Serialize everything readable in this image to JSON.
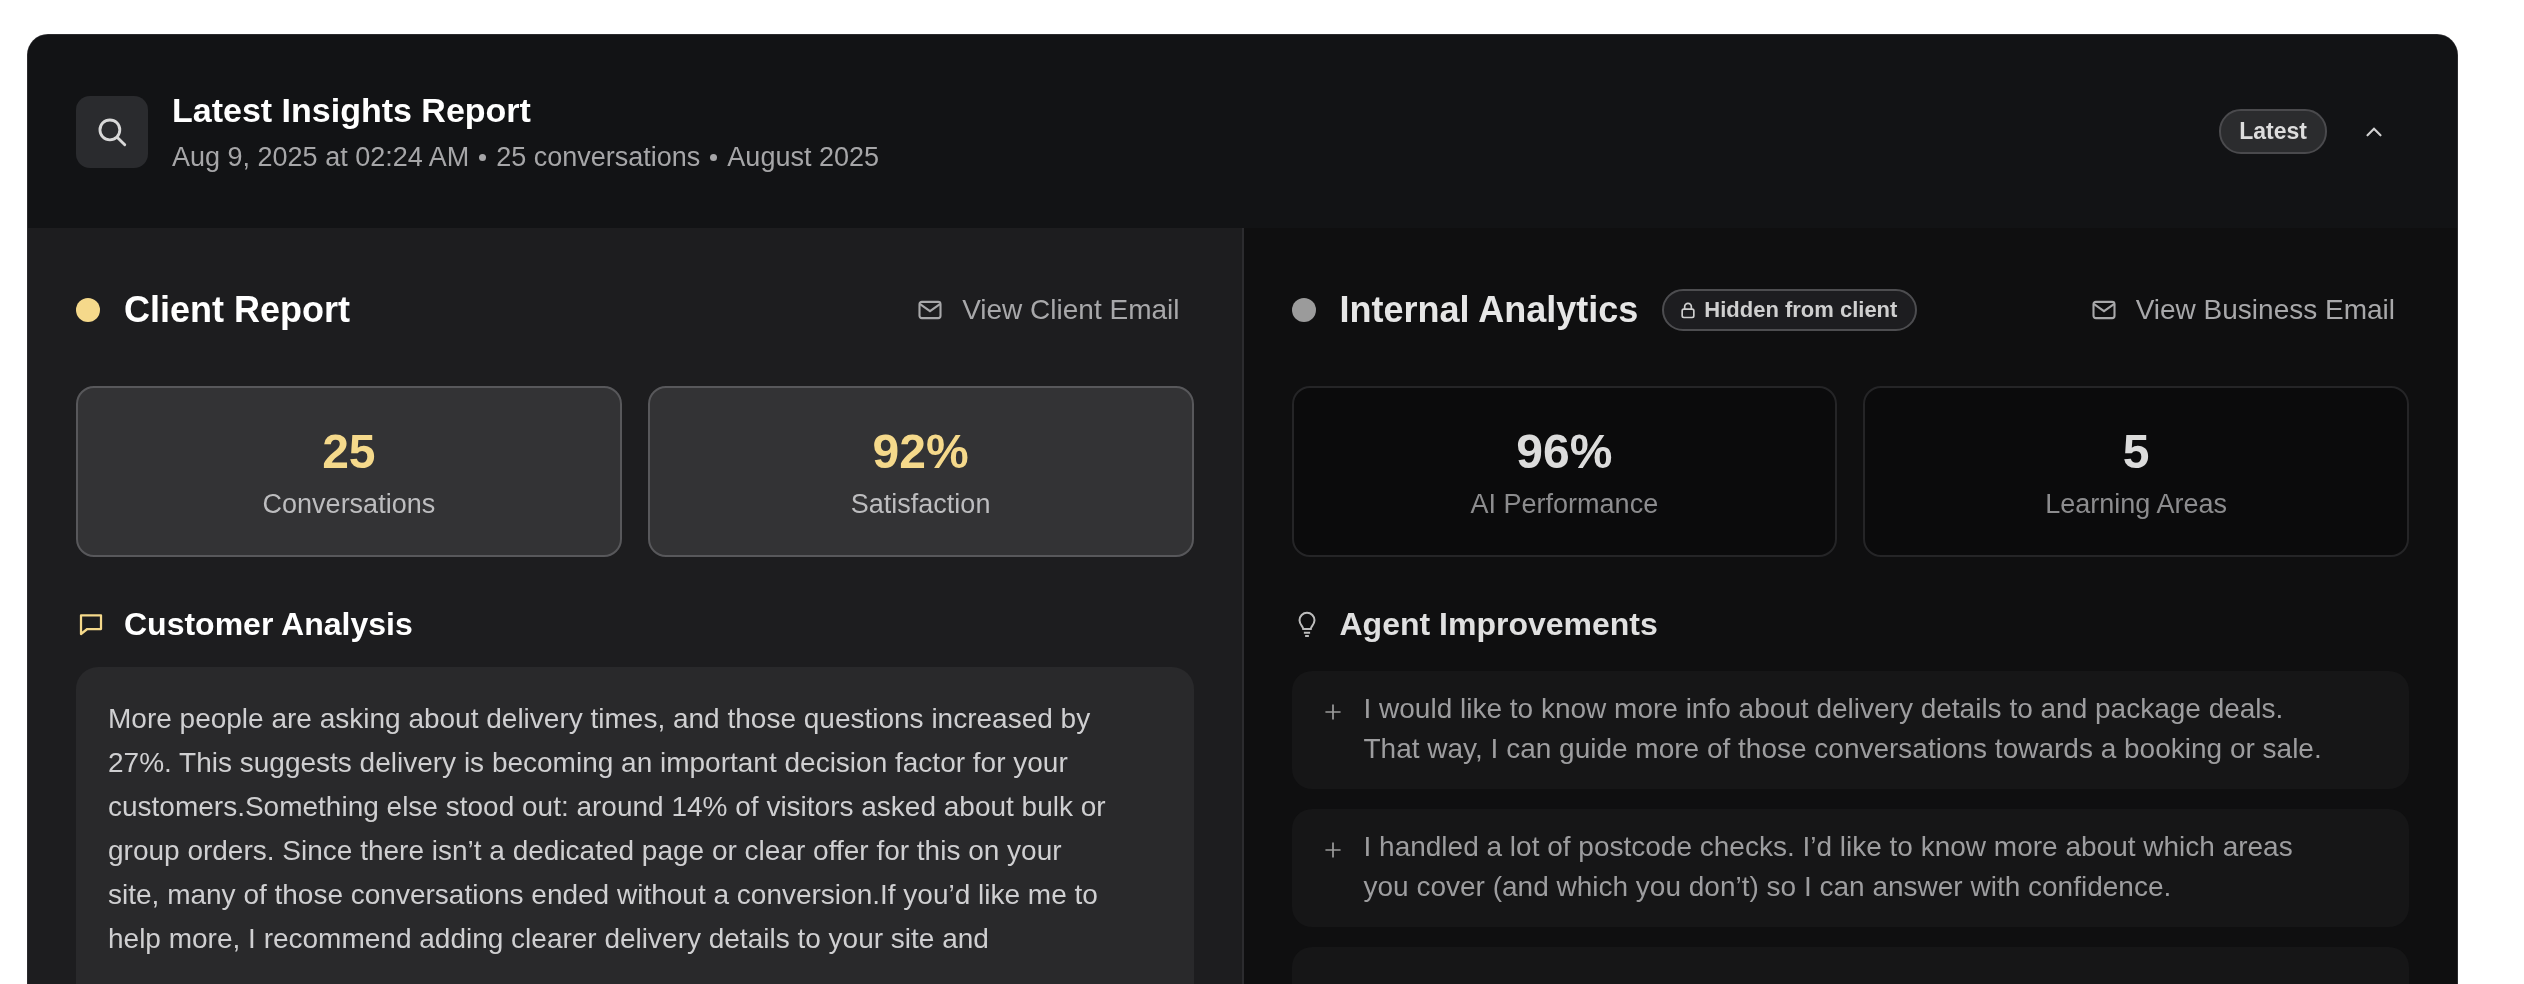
{
  "header": {
    "title": "Latest Insights Report",
    "meta": [
      "Aug 9, 2025 at 02:24 AM",
      "25 conversations",
      "August 2025"
    ],
    "badge": "Latest",
    "expanded": true
  },
  "panels": [
    {
      "kind": "client",
      "title": "Client Report",
      "color": "#f5d98b",
      "action": "View Client Email",
      "stats": [
        {
          "value": "25",
          "label": "Conversations"
        },
        {
          "value": "92%",
          "label": "Satisfaction"
        }
      ],
      "section": {
        "kind": "analysis",
        "title": "Customer Analysis",
        "lines": [
          "More people are asking about delivery times, and those questions increased by",
          "27%. This suggests delivery is becoming an important decision factor for your",
          "customers.Something else stood out: around 14% of visitors asked about bulk or",
          "group orders. Since there isn’t a dedicated page or clear offer for this on your",
          "site, many of those conversations ended without a conversion.If you’d like me to",
          "help more, I recommend adding clearer delivery details to your site and"
        ]
      }
    },
    {
      "kind": "internal",
      "title": "Internal Analytics",
      "color": "#9b9b9b",
      "tag": "Hidden from client",
      "action": "View Business Email",
      "stats": [
        {
          "value": "96%",
          "label": "AI Performance"
        },
        {
          "value": "5",
          "label": "Learning Areas"
        }
      ],
      "section": {
        "kind": "improvements",
        "title": "Agent Improvements",
        "items": [
          {
            "lines": [
              "I would like to know more info about delivery details to and package deals.",
              "That way, I can guide more of those conversations towards a booking or sale."
            ]
          },
          {
            "lines": [
              "I handled a lot of postcode checks. I’d like to know more about which areas",
              "you cover (and which you don’t) so I can answer with confidence."
            ]
          }
        ]
      }
    }
  ]
}
